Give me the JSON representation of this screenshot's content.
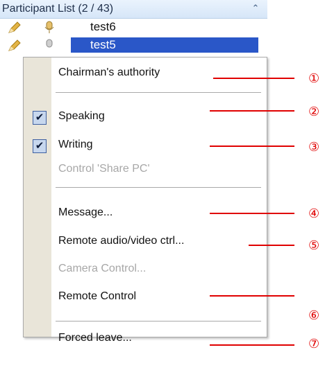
{
  "panel": {
    "title": "Participant List (2 / 43)",
    "collapse_icon": "double-chevron-up-icon"
  },
  "participants": [
    {
      "name": "test6",
      "selected": false
    },
    {
      "name": "test5",
      "selected": true
    }
  ],
  "menu": {
    "chairman": {
      "label": "Chairman's authority"
    },
    "speaking": {
      "label": "Speaking",
      "checked": true
    },
    "writing": {
      "label": "Writing",
      "checked": true
    },
    "share_pc": {
      "label": "Control 'Share PC'",
      "disabled": true
    },
    "message": {
      "label": "Message..."
    },
    "remote_av": {
      "label": "Remote audio/video ctrl..."
    },
    "camera": {
      "label": "Camera Control...",
      "disabled": true
    },
    "remote_control": {
      "label": "Remote Control"
    },
    "forced_leave": {
      "label": "Forced leave..."
    }
  },
  "annotations": [
    "①",
    "②",
    "③",
    "④",
    "⑤",
    "⑥",
    "⑦"
  ],
  "colors": {
    "accent": "#2a57c8",
    "annotation": "#e00000",
    "gutter": "#e9e5d9"
  }
}
